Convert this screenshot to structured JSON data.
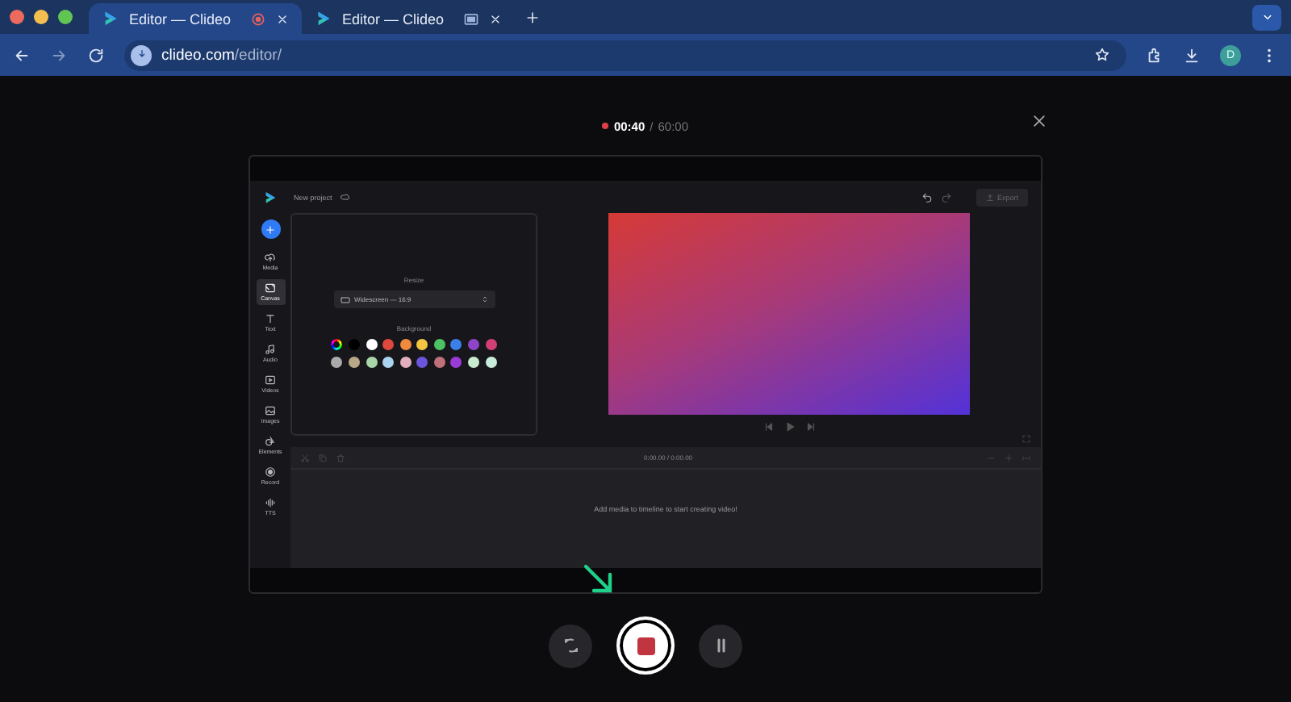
{
  "browser": {
    "tabs": [
      {
        "title": "Editor — Clideo",
        "selected": true
      },
      {
        "title": "Editor — Clideo",
        "selected": false
      }
    ],
    "url_host": "clideo.com",
    "url_path": "/editor/",
    "profile_initial": "D"
  },
  "recorder": {
    "elapsed": "00:40",
    "separator": "/",
    "limit": "60:00",
    "recording": true
  },
  "editor": {
    "project_name": "New project",
    "export_label": "Export",
    "sidebar": [
      {
        "label": "Media",
        "selected": false
      },
      {
        "label": "Canvas",
        "selected": true
      },
      {
        "label": "Text",
        "selected": false
      },
      {
        "label": "Audio",
        "selected": false
      },
      {
        "label": "Videos",
        "selected": false
      },
      {
        "label": "Images",
        "selected": false
      },
      {
        "label": "Elements",
        "selected": false
      },
      {
        "label": "Record",
        "selected": false
      },
      {
        "label": "TTS",
        "selected": false
      }
    ],
    "resize_heading": "Resize",
    "resize_value": "Widescreen — 16:9",
    "background_heading": "Background",
    "swatches": [
      {
        "kind": "picker"
      },
      {
        "kind": "solid",
        "color": "#000000"
      },
      {
        "kind": "solid",
        "color": "#ffffff"
      },
      {
        "kind": "solid",
        "color": "#e0483e"
      },
      {
        "kind": "solid",
        "color": "#f08a3c"
      },
      {
        "kind": "solid",
        "color": "#f5c542"
      },
      {
        "kind": "solid",
        "color": "#4cc262"
      },
      {
        "kind": "solid",
        "color": "#3b7fe8"
      },
      {
        "kind": "solid",
        "color": "#8e44c9"
      },
      {
        "kind": "solid",
        "color": "#d23f77"
      },
      {
        "kind": "solid",
        "color": "#aaaaaa"
      },
      {
        "kind": "solid",
        "color": "#b8a888"
      },
      {
        "kind": "solid",
        "color": "#a9d5a9"
      },
      {
        "kind": "solid",
        "color": "#a9d3ee"
      },
      {
        "kind": "solid",
        "color": "#e2aebd"
      },
      {
        "kind": "solid",
        "color": "#6a55dc"
      },
      {
        "kind": "solid",
        "color": "#c0707a"
      },
      {
        "kind": "solid",
        "color": "#9a3ad8"
      },
      {
        "kind": "solid",
        "color": "#c8ecd0"
      },
      {
        "kind": "solid",
        "color": "#c8ecdc"
      }
    ],
    "timecode": "0:00.00 / 0:00.00",
    "timeline_hint": "Add media to timeline to start creating video!"
  }
}
